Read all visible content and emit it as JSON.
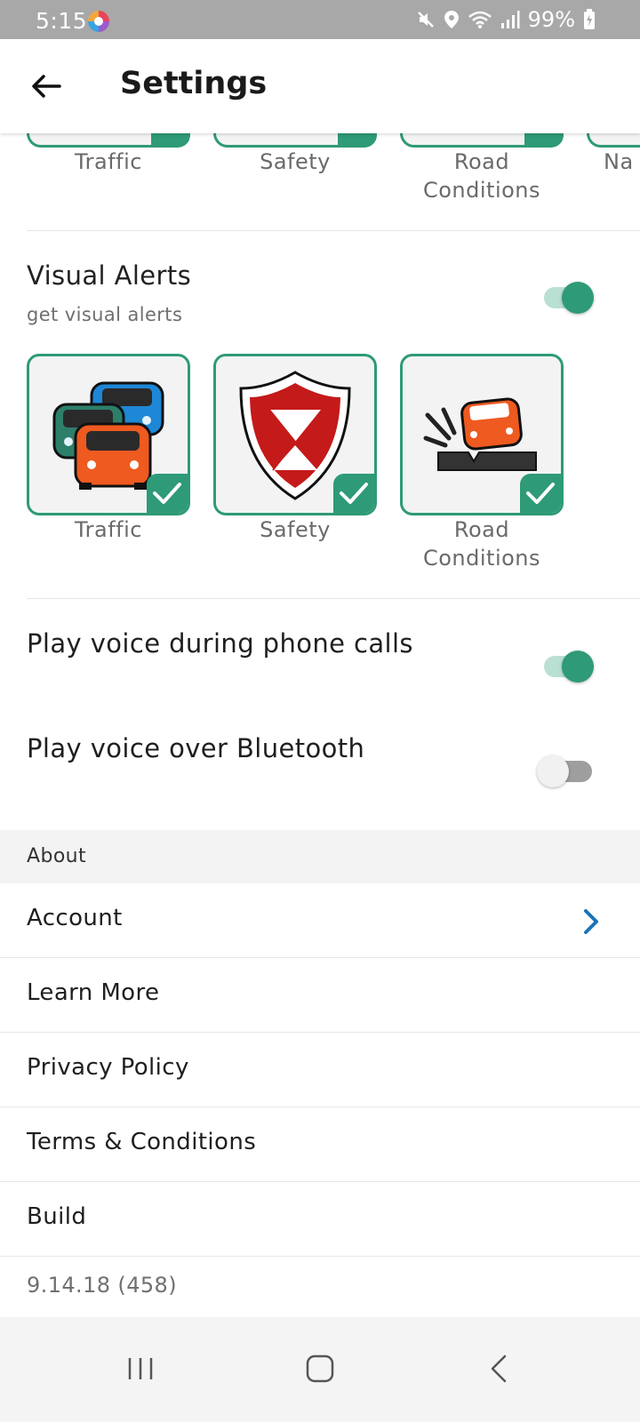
{
  "status_bar": {
    "time": "5:15",
    "battery": "99%"
  },
  "app_bar": {
    "title": "Settings"
  },
  "audio_alerts": {
    "tiles": [
      {
        "label": "Traffic",
        "selected": true
      },
      {
        "label": "Safety",
        "selected": true
      },
      {
        "label": "Road\nConditions",
        "selected": true
      },
      {
        "label": "Na",
        "selected": true
      }
    ]
  },
  "visual_alerts": {
    "title": "Visual Alerts",
    "subtitle": "get visual alerts",
    "enabled": true,
    "tiles": [
      {
        "label": "Traffic",
        "icon": "traffic-cars-icon",
        "selected": true
      },
      {
        "label": "Safety",
        "icon": "safety-shield-icon",
        "selected": true
      },
      {
        "label": "Road\nConditions",
        "icon": "road-conditions-icon",
        "selected": true
      }
    ]
  },
  "toggles": {
    "phone_calls": {
      "label": "Play voice during phone calls",
      "enabled": true
    },
    "bluetooth": {
      "label": "Play voice over Bluetooth",
      "enabled": false
    }
  },
  "about": {
    "header": "About",
    "items": [
      {
        "label": "Account"
      },
      {
        "label": "Learn More"
      },
      {
        "label": "Privacy Policy"
      },
      {
        "label": "Terms & Conditions"
      },
      {
        "label": "Build"
      }
    ],
    "build_value": "9.14.18 (458)"
  },
  "colors": {
    "accent": "#2e9a78",
    "link_chevron": "#1a73b8"
  }
}
